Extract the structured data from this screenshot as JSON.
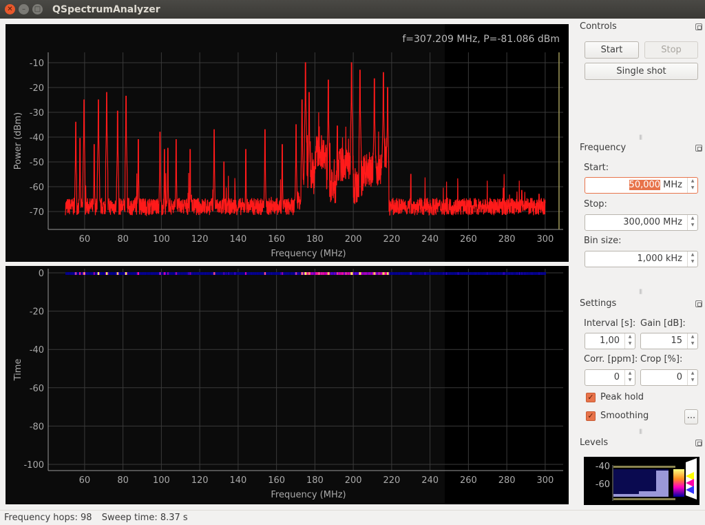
{
  "window": {
    "title": "QSpectrumAnalyzer"
  },
  "spectrum": {
    "cursor_readout": "f=307.209 MHz, P=-81.086 dBm"
  },
  "chart_data": [
    {
      "type": "line",
      "xlabel": "Frequency (MHz)",
      "ylabel": "Power (dBm)",
      "xlim": [
        41,
        309.5
      ],
      "ylim": [
        -77,
        -6
      ],
      "xticks": [
        60,
        80,
        100,
        120,
        140,
        160,
        180,
        200,
        220,
        240,
        260,
        280,
        300
      ],
      "yticks": [
        -10,
        -20,
        -30,
        -40,
        -50,
        -60,
        -70
      ],
      "grid": true,
      "line_color": "#ff1a1a",
      "cursor_frequency": 307.209,
      "data_range": [
        50,
        300
      ],
      "noise_floor": [
        {
          "from": 50,
          "to": 170,
          "level": -68
        },
        {
          "from": 170,
          "to": 173,
          "level": -66
        },
        {
          "from": 173,
          "to": 180,
          "level": -56
        },
        {
          "from": 180,
          "to": 186,
          "level": -46
        },
        {
          "from": 186,
          "to": 192,
          "level": -60
        },
        {
          "from": 192,
          "to": 200,
          "level": -51
        },
        {
          "from": 200,
          "to": 205,
          "level": -60
        },
        {
          "from": 205,
          "to": 215,
          "level": -53
        },
        {
          "from": 215,
          "to": 218,
          "level": -46
        },
        {
          "from": 218,
          "to": 300,
          "level": -68
        }
      ],
      "peaks": [
        {
          "f": 55.4,
          "p": -34
        },
        {
          "f": 57.6,
          "p": -40.5
        },
        {
          "f": 59.7,
          "p": -25
        },
        {
          "f": 65,
          "p": -43
        },
        {
          "f": 67.2,
          "p": -25
        },
        {
          "f": 71.5,
          "p": -22
        },
        {
          "f": 77.2,
          "p": -29.5
        },
        {
          "f": 81.6,
          "p": -23.5
        },
        {
          "f": 88,
          "p": -41
        },
        {
          "f": 99.3,
          "p": -38
        },
        {
          "f": 101.6,
          "p": -45
        },
        {
          "f": 103.4,
          "p": -44.5
        },
        {
          "f": 107.7,
          "p": -41
        },
        {
          "f": 115,
          "p": -45
        },
        {
          "f": 127.5,
          "p": -37
        },
        {
          "f": 132.6,
          "p": -50
        },
        {
          "f": 144,
          "p": -45
        },
        {
          "f": 154,
          "p": -37
        },
        {
          "f": 163,
          "p": -43
        },
        {
          "f": 170.2,
          "p": -35
        },
        {
          "f": 173.3,
          "p": -25
        },
        {
          "f": 175.1,
          "p": -10
        },
        {
          "f": 177,
          "p": -22
        },
        {
          "f": 187,
          "p": -17
        },
        {
          "f": 191.7,
          "p": -35.5
        },
        {
          "f": 199.1,
          "p": -10
        },
        {
          "f": 203.5,
          "p": -13
        },
        {
          "f": 211,
          "p": -16.5
        },
        {
          "f": 215.7,
          "p": -14
        },
        {
          "f": 217.9,
          "p": -20
        },
        {
          "f": 230,
          "p": -55
        },
        {
          "f": 287.8,
          "p": -61.5
        },
        {
          "f": 296.8,
          "p": -63
        }
      ]
    },
    {
      "type": "heatmap",
      "xlabel": "Frequency (MHz)",
      "ylabel": "Time",
      "xlim": [
        41,
        309.5
      ],
      "ylim": [
        -104,
        1
      ],
      "xticks": [
        60,
        80,
        100,
        120,
        140,
        160,
        180,
        200,
        220,
        240,
        260,
        280,
        300
      ],
      "yticks": [
        0,
        -20,
        -40,
        -60,
        -80,
        -100
      ],
      "rows_shown": 1
    }
  ],
  "controls": {
    "title": "Controls",
    "start": "Start",
    "stop": "Stop",
    "single_shot": "Single shot"
  },
  "frequency": {
    "title": "Frequency",
    "start_label": "Start:",
    "start_value": "50,000",
    "start_unit": " MHz",
    "stop_label": "Stop:",
    "stop_value": "300,000 MHz",
    "bin_label": "Bin size:",
    "bin_value": "1,000 kHz"
  },
  "settings": {
    "title": "Settings",
    "interval_label": "Interval [s]:",
    "interval_value": "1,00",
    "gain_label": "Gain [dB]:",
    "gain_value": "15",
    "corr_label": "Corr. [ppm]:",
    "corr_value": "0",
    "crop_label": "Crop [%]:",
    "crop_value": "0",
    "peak_hold_label": "Peak hold",
    "peak_hold": true,
    "smoothing_label": "Smoothing",
    "smoothing": true,
    "smoothing_options": "..."
  },
  "levels": {
    "title": "Levels",
    "tick_high": "-40",
    "tick_low": "-60"
  },
  "status": {
    "hops": "Frequency hops: 98",
    "sweep": "Sweep time: 8.37 s"
  }
}
